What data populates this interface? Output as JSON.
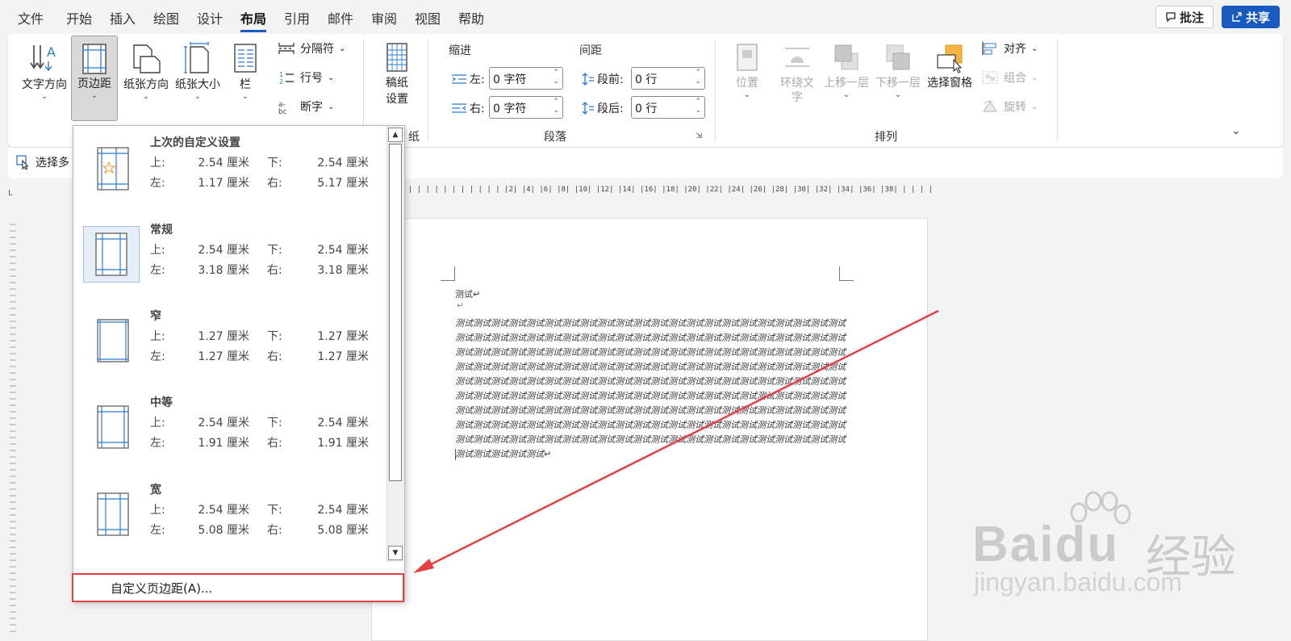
{
  "menu": {
    "tabs": [
      "文件",
      "开始",
      "插入",
      "绘图",
      "设计",
      "布局",
      "引用",
      "邮件",
      "审阅",
      "视图",
      "帮助"
    ],
    "active": "布局",
    "comment_label": "批注",
    "share_label": "共享"
  },
  "ribbon": {
    "text_direction": "文字方向",
    "margins": "页边距",
    "orientation": "纸张方向",
    "size": "纸张大小",
    "columns": "栏",
    "breaks": "分隔符",
    "line_numbers": "行号",
    "hyphenation": "断字",
    "manuscript_line1": "稿纸",
    "manuscript_line2": "设置",
    "manuscript_group": "纸",
    "indent_title": "缩进",
    "spacing_title": "间距",
    "indent_left_label": "左:",
    "indent_left_value": "0 字符",
    "indent_right_label": "右:",
    "indent_right_value": "0 字符",
    "spacing_before_label": "段前:",
    "spacing_before_value": "0 行",
    "spacing_after_label": "段后:",
    "spacing_after_value": "0 行",
    "paragraph_group": "段落",
    "position": "位置",
    "wrap_line1": "环绕文",
    "wrap_line2": "字",
    "bring_forward": "上移一层",
    "send_backward": "下移一层",
    "selection_pane": "选择窗格",
    "align": "对齐",
    "group": "组合",
    "rotate": "旋转",
    "arrange_group": "排列"
  },
  "quick": {
    "select_label": "选择多"
  },
  "dropdown": {
    "presets": [
      {
        "name": "上次的自定义设置",
        "top_label": "上:",
        "top": "2.54 厘米",
        "bottom_label": "下:",
        "bottom": "2.54 厘米",
        "left_label": "左:",
        "left": "1.17 厘米",
        "right_label": "右:",
        "right": "5.17 厘米"
      },
      {
        "name": "常规",
        "top_label": "上:",
        "top": "2.54 厘米",
        "bottom_label": "下:",
        "bottom": "2.54 厘米",
        "left_label": "左:",
        "left": "3.18 厘米",
        "right_label": "右:",
        "right": "3.18 厘米"
      },
      {
        "name": "窄",
        "top_label": "上:",
        "top": "1.27 厘米",
        "bottom_label": "下:",
        "bottom": "1.27 厘米",
        "left_label": "左:",
        "left": "1.27 厘米",
        "right_label": "右:",
        "right": "1.27 厘米"
      },
      {
        "name": "中等",
        "top_label": "上:",
        "top": "2.54 厘米",
        "bottom_label": "下:",
        "bottom": "2.54 厘米",
        "left_label": "左:",
        "left": "1.91 厘米",
        "right_label": "右:",
        "right": "1.91 厘米"
      },
      {
        "name": "宽",
        "top_label": "上:",
        "top": "2.54 厘米",
        "bottom_label": "下:",
        "bottom": "2.54 厘米",
        "left_label": "左:",
        "left": "5.08 厘米",
        "right_label": "右:",
        "right": "5.08 厘米"
      }
    ],
    "custom_label": "自定义页边距(A)..."
  },
  "document": {
    "title": "测试↵",
    "empty_para": "↵",
    "body": "测试测试测试测试测试测试测试测试测试测试测试测试测试测试测试测试测试测试测试测试测试测试测试测试测试测试测试测试测试测试测试测试测试测试测试测试测试测试测试测试测试测试测试测试测试测试测试测试测试测试测试测试测试测试测试测试测试测试测试测试测试测试测试测试测试测试测试测试测试测试测试测试测试测试测试测试测试测试测试测试测试测试测试测试测试测试测试测试测试测试测试测试测试测试测试测试测试测试测试测试测试测试测试测试测试测试测试测试测试测试测试测试测试测试测试测试测试测试测试测试测试测试测试测试测试测试测试测试测试测试测试测试测试测试测试测试测试测试测试测试测试测试测试测试测试测试测试测试测试测试测试测试测试测试测试测试测试测试测试测试测试测试测试测试测试测试测试测试测试测试测试测试测试测试测试测试测试测试测试测试测试测试测试测试测试测试测试测试测试测试测试测试测试测试测试测试测试测试测试测试测试测试测试↵",
    "ruler_h": "| | | | | | | | | | | | |2|  |4|  |6|  |8|  |10|  |12|  |14|  |16|  |18|  |20|  |22|  |24|  |26|  |28|  |30|  |32|  |34|  |36|  |38|  | | | | |"
  },
  "watermark": {
    "brand": "Bai",
    "brand_end": "du",
    "cn": "经验",
    "url": "jingyan.baidu.com"
  },
  "colors": {
    "accent": "#185abd",
    "highlight_box": "#e64040"
  }
}
